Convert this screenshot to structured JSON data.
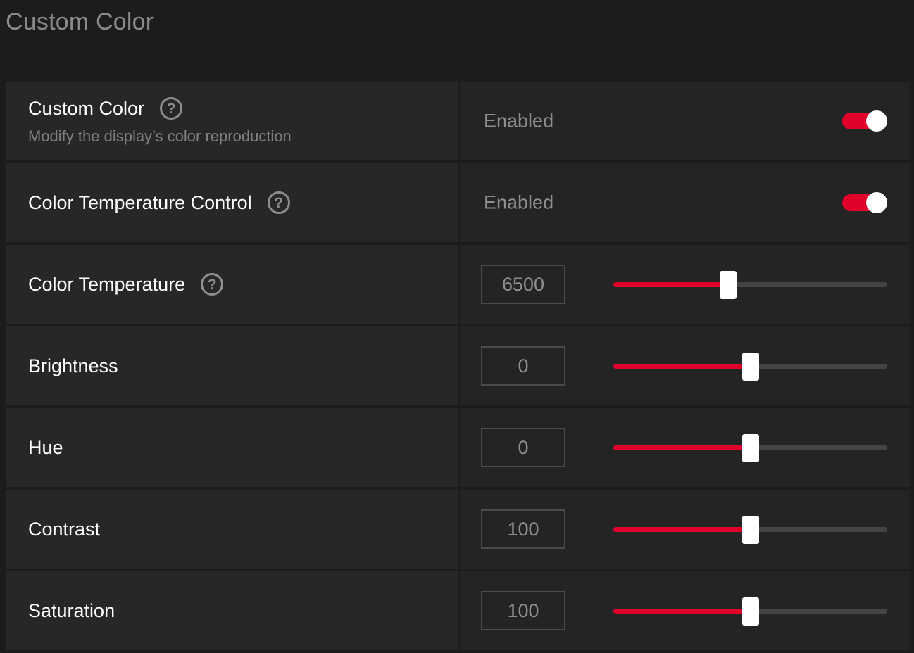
{
  "page": {
    "title": "Custom Color"
  },
  "rows": [
    {
      "label": "Custom Color",
      "description": "Modify the display’s color reproduction",
      "help_icon": "question-circle-icon",
      "help_glyph": "?",
      "status": "Enabled",
      "toggle_on": true
    },
    {
      "label": "Color Temperature Control",
      "help_icon": "question-circle-icon",
      "help_glyph": "?",
      "status": "Enabled",
      "toggle_on": true
    },
    {
      "label": "Color Temperature",
      "help_icon": "question-circle-icon",
      "help_glyph": "?",
      "value": "6500",
      "slider_level": 0.42
    },
    {
      "label": "Brightness",
      "value": "0",
      "slider_level": 0.5
    },
    {
      "label": "Hue",
      "value": "0",
      "slider_level": 0.5
    },
    {
      "label": "Contrast",
      "value": "100",
      "slider_level": 0.5
    },
    {
      "label": "Saturation",
      "value": "100",
      "slider_level": 0.5
    }
  ],
  "colors": {
    "accent": "#e1002a",
    "background": "#1c1c1c",
    "panel": "#272727",
    "muted_text": "#8e8e8e"
  }
}
